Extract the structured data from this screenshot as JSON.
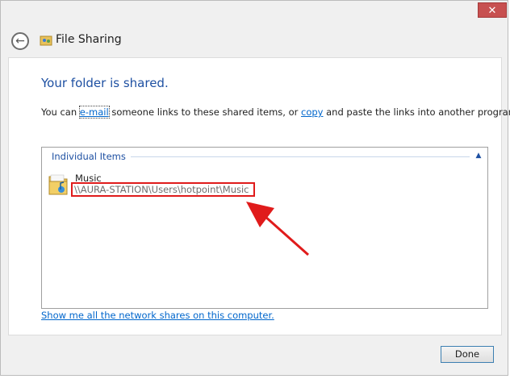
{
  "window": {
    "close_label": "✕",
    "back_label": "←",
    "title": "File Sharing"
  },
  "main": {
    "heading": "Your folder is shared.",
    "desc_prefix": "You can ",
    "email_link": "e-mail",
    "desc_middle": " someone links to these shared items, or ",
    "copy_link": "copy",
    "desc_suffix": " and paste the links into another program."
  },
  "items": {
    "group_label": "Individual Items",
    "collapse_label": "^",
    "list": [
      {
        "name": "Music",
        "path": "\\\\AURA-STATION\\Users\\hotpoint\\Music"
      }
    ]
  },
  "footer": {
    "network_link": "Show me all the network shares on this computer.",
    "done_label": "Done"
  },
  "colors": {
    "accent": "#1e50a2",
    "link": "#0066cc",
    "highlight": "#e01b1b"
  },
  "icons": [
    "back-arrow-icon",
    "file-sharing-icon",
    "close-icon",
    "collapse-chevron-icon",
    "music-folder-icon",
    "red-arrow-annotation"
  ]
}
